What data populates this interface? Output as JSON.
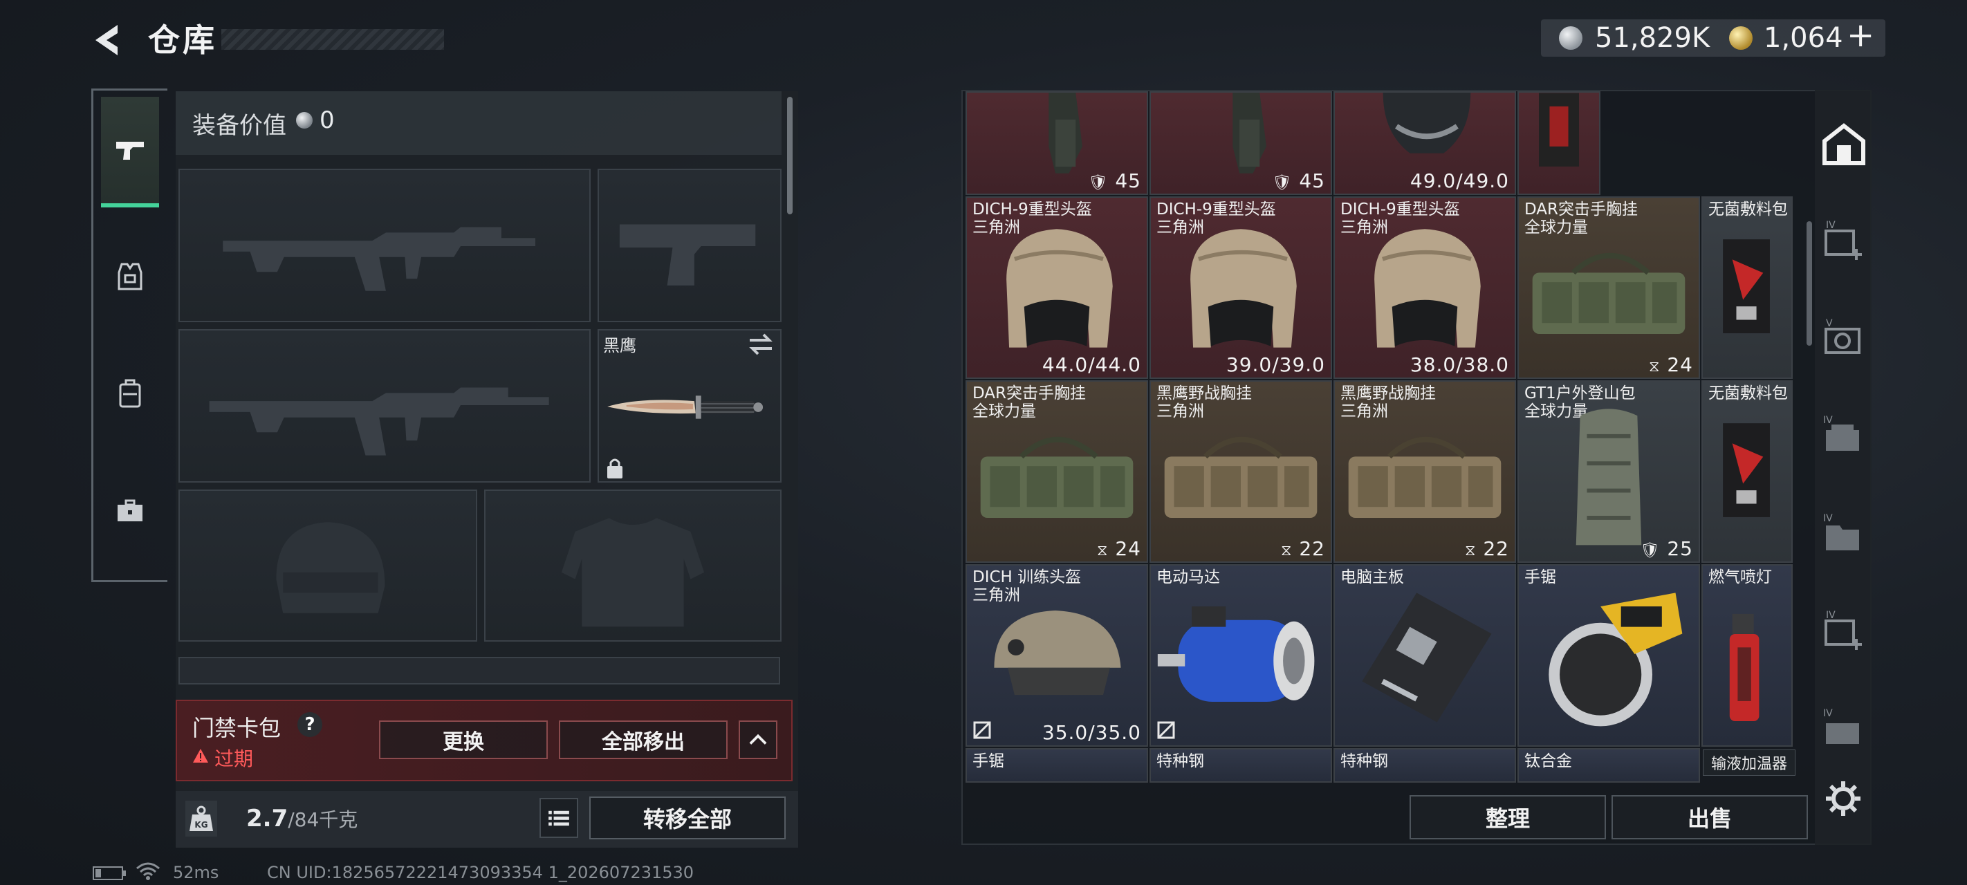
{
  "header": {
    "title": "仓库",
    "silver_amount": "51,829K",
    "gold_amount": "1,064",
    "plus": "+"
  },
  "equipment": {
    "value_label": "装备价值",
    "value": "0",
    "knife_name": "黑鹰",
    "access_card_label": "门禁卡包",
    "help_mark": "?",
    "expired_label": "过期",
    "replace_button": "更换",
    "remove_all_button": "全部移出",
    "weight": "2.7",
    "weight_capacity": "/84千克",
    "transfer_all_button": "转移全部"
  },
  "inventory": {
    "cells": [
      {
        "name": "",
        "sub": "",
        "value": "45"
      },
      {
        "name": "",
        "sub": "",
        "value": "45"
      },
      {
        "name": "",
        "sub": "",
        "value": "49.0/49.0"
      },
      {
        "name": "DICH-9重型头盔",
        "sub": "三角洲",
        "value": "44.0/44.0"
      },
      {
        "name": "DICH-9重型头盔",
        "sub": "三角洲",
        "value": "39.0/39.0"
      },
      {
        "name": "DICH-9重型头盔",
        "sub": "三角洲",
        "value": "38.0/38.0"
      },
      {
        "name": "DAR突击手胸挂",
        "sub": "全球力量",
        "value": "24"
      },
      {
        "name": "无菌敷料包",
        "sub": "",
        "value": ""
      },
      {
        "name": "DAR突击手胸挂",
        "sub": "全球力量",
        "value": "24"
      },
      {
        "name": "黑鹰野战胸挂",
        "sub": "三角洲",
        "value": "22"
      },
      {
        "name": "黑鹰野战胸挂",
        "sub": "三角洲",
        "value": "22"
      },
      {
        "name": "GT1户外登山包",
        "sub": "全球力量",
        "value": "25"
      },
      {
        "name": "无菌敷料包",
        "sub": "",
        "value": ""
      },
      {
        "name": "DICH 训练头盔",
        "sub": "三角洲",
        "value": "35.0/35.0"
      },
      {
        "name": "电动马达",
        "sub": "",
        "value": ""
      },
      {
        "name": "电脑主板",
        "sub": "",
        "value": ""
      },
      {
        "name": "手锯",
        "sub": "",
        "value": ""
      },
      {
        "name": "燃气喷灯",
        "sub": "",
        "value": ""
      },
      {
        "name": "手锯",
        "sub": "",
        "value": ""
      },
      {
        "name": "特种钢",
        "sub": "",
        "value": ""
      },
      {
        "name": "特种钢",
        "sub": "",
        "value": ""
      },
      {
        "name": "钛合金",
        "sub": "",
        "value": ""
      }
    ],
    "tooltip": "输液加温器",
    "arrange_button": "整理",
    "sell_button": "出售"
  },
  "status": {
    "ping": "52ms",
    "uid": "CN UID:18256572221473093354 1_202607231530"
  },
  "colors": {
    "accent_green": "#44d39a",
    "warning_red": "#ff5a5a",
    "card_bg": "#4a1e22"
  }
}
